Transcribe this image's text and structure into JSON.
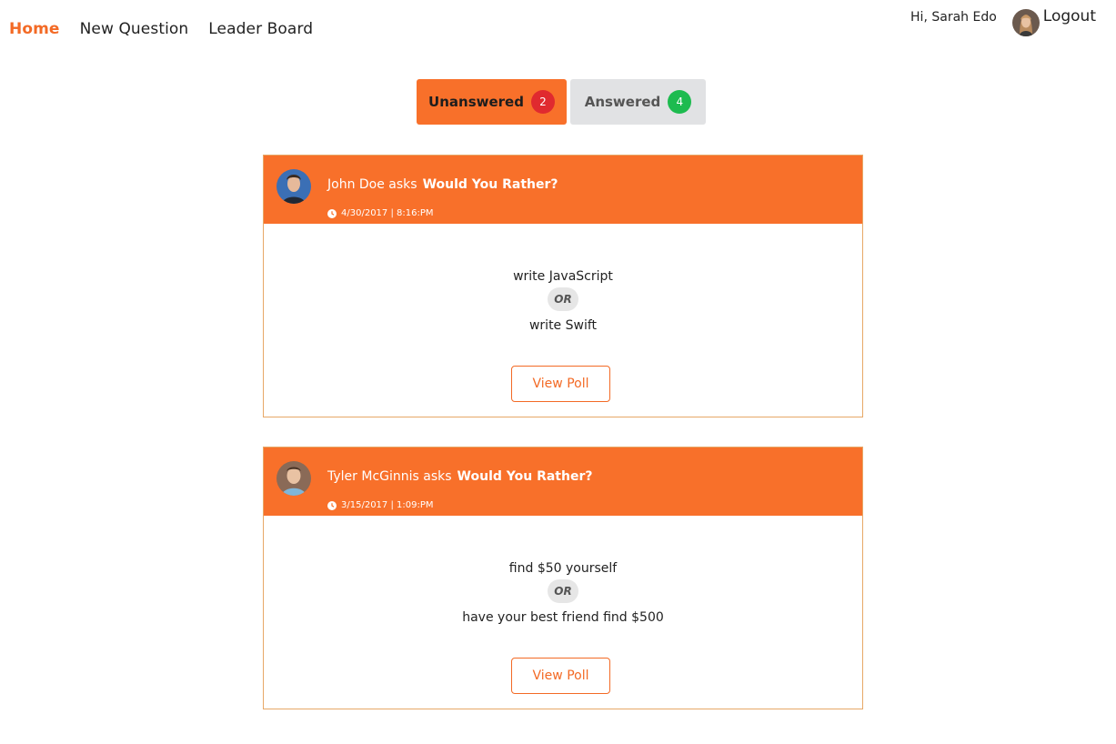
{
  "nav": {
    "home": "Home",
    "new_question": "New Question",
    "leader_board": "Leader Board"
  },
  "user": {
    "greeting": "Hi, Sarah Edo",
    "logout": "Logout"
  },
  "tabs": {
    "unanswered": {
      "label": "Unanswered",
      "count": "2"
    },
    "answered": {
      "label": "Answered",
      "count": "4"
    }
  },
  "questions": [
    {
      "asker": "John Doe asks",
      "title": "Would You Rather?",
      "timestamp": "4/30/2017 | 8:16:PM",
      "option_one": "write JavaScript",
      "or": "OR",
      "option_two": "write Swift",
      "button": "View Poll"
    },
    {
      "asker": "Tyler McGinnis asks",
      "title": "Would You Rather?",
      "timestamp": "3/15/2017 | 1:09:PM",
      "option_one": "find $50 yourself",
      "or": "OR",
      "option_two": "have your best friend find $500",
      "button": "View Poll"
    }
  ],
  "colors": {
    "accent": "#f8702a",
    "badge_red": "#e02a2f",
    "badge_green": "#1dbb4f"
  }
}
